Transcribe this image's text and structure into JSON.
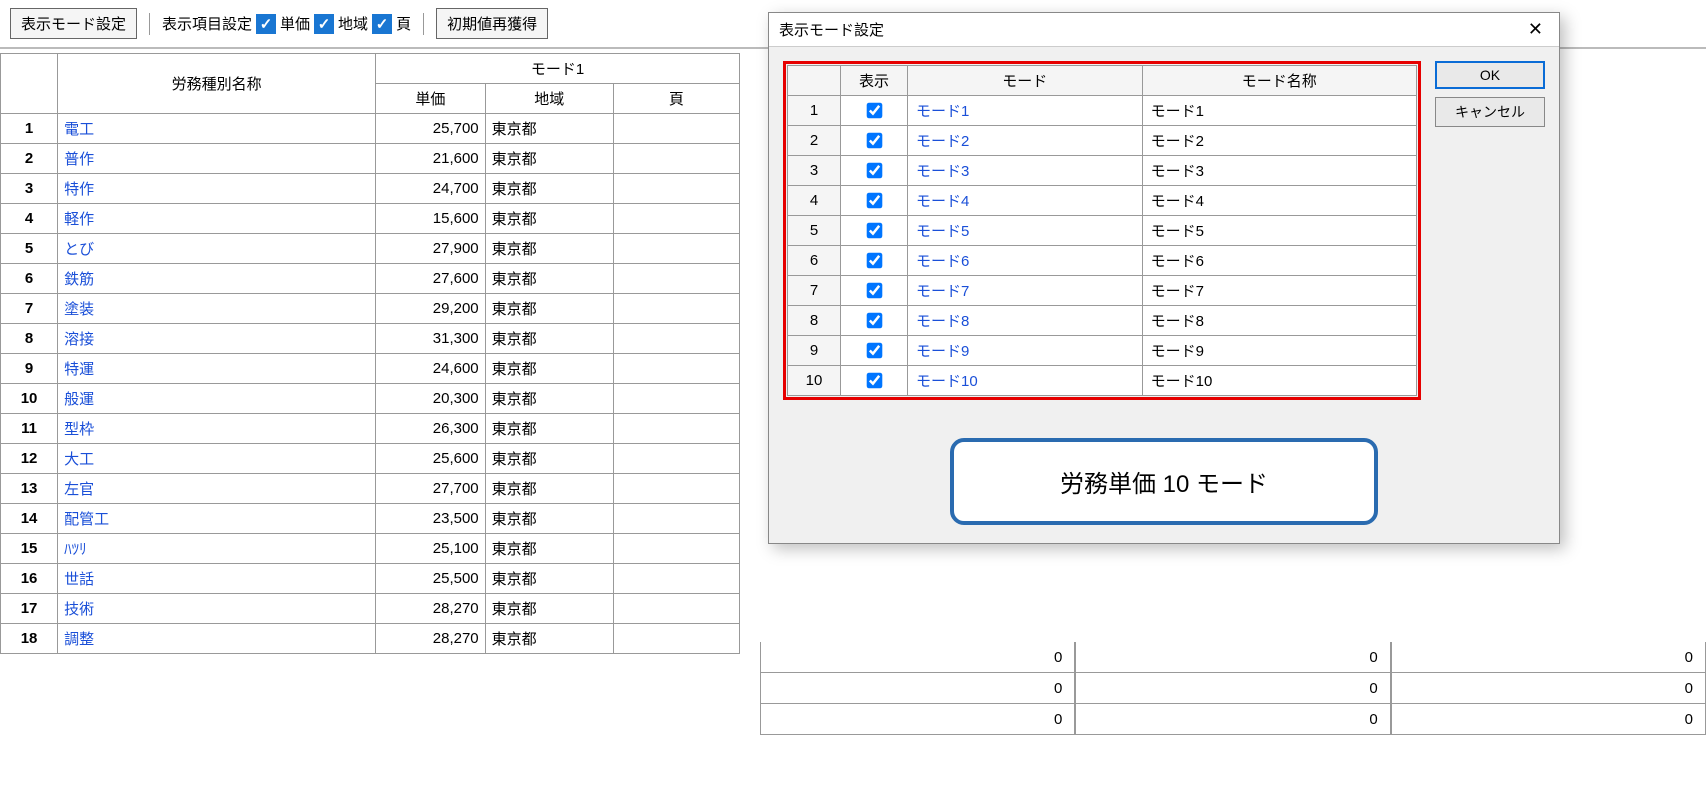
{
  "toolbar": {
    "mode_btn": "表示モード設定",
    "item_btn": "表示項目設定",
    "cb1_label": "単価",
    "cb2_label": "地域",
    "cb3_label": "頁",
    "reset_btn": "初期値再獲得"
  },
  "headers": {
    "labor_name": "労務種別名称",
    "mode_group": "モード1",
    "price": "単価",
    "region": "地域",
    "page": "頁"
  },
  "rows": [
    {
      "n": 1,
      "name": "電工",
      "price": "25,700",
      "region": "東京都",
      "page": ""
    },
    {
      "n": 2,
      "name": "普作",
      "price": "21,600",
      "region": "東京都",
      "page": ""
    },
    {
      "n": 3,
      "name": "特作",
      "price": "24,700",
      "region": "東京都",
      "page": ""
    },
    {
      "n": 4,
      "name": "軽作",
      "price": "15,600",
      "region": "東京都",
      "page": ""
    },
    {
      "n": 5,
      "name": "とび",
      "price": "27,900",
      "region": "東京都",
      "page": ""
    },
    {
      "n": 6,
      "name": "鉄筋",
      "price": "27,600",
      "region": "東京都",
      "page": ""
    },
    {
      "n": 7,
      "name": "塗装",
      "price": "29,200",
      "region": "東京都",
      "page": ""
    },
    {
      "n": 8,
      "name": "溶接",
      "price": "31,300",
      "region": "東京都",
      "page": ""
    },
    {
      "n": 9,
      "name": "特運",
      "price": "24,600",
      "region": "東京都",
      "page": ""
    },
    {
      "n": 10,
      "name": "般運",
      "price": "20,300",
      "region": "東京都",
      "page": ""
    },
    {
      "n": 11,
      "name": "型枠",
      "price": "26,300",
      "region": "東京都",
      "page": ""
    },
    {
      "n": 12,
      "name": "大工",
      "price": "25,600",
      "region": "東京都",
      "page": ""
    },
    {
      "n": 13,
      "name": "左官",
      "price": "27,700",
      "region": "東京都",
      "page": ""
    },
    {
      "n": 14,
      "name": "配管工",
      "price": "23,500",
      "region": "東京都",
      "page": ""
    },
    {
      "n": 15,
      "name": "ﾊﾂﾘ",
      "price": "25,100",
      "region": "東京都",
      "page": ""
    },
    {
      "n": 16,
      "name": "世話",
      "price": "25,500",
      "region": "東京都",
      "page": ""
    },
    {
      "n": 17,
      "name": "技術",
      "price": "28,270",
      "region": "東京都",
      "page": ""
    },
    {
      "n": 18,
      "name": "調整",
      "price": "28,270",
      "region": "東京都",
      "page": ""
    }
  ],
  "bg_zero": "0",
  "dialog": {
    "title": "表示モード設定",
    "ok": "OK",
    "cancel": "キャンセル",
    "hdr_disp": "表示",
    "hdr_mode": "モード",
    "hdr_name": "モード名称",
    "modes": [
      {
        "n": 1,
        "mode": "モード1",
        "name": "モード1"
      },
      {
        "n": 2,
        "mode": "モード2",
        "name": "モード2"
      },
      {
        "n": 3,
        "mode": "モード3",
        "name": "モード3"
      },
      {
        "n": 4,
        "mode": "モード4",
        "name": "モード4"
      },
      {
        "n": 5,
        "mode": "モード5",
        "name": "モード5"
      },
      {
        "n": 6,
        "mode": "モード6",
        "name": "モード6"
      },
      {
        "n": 7,
        "mode": "モード7",
        "name": "モード7"
      },
      {
        "n": 8,
        "mode": "モード8",
        "name": "モード8"
      },
      {
        "n": 9,
        "mode": "モード9",
        "name": "モード9"
      },
      {
        "n": 10,
        "mode": "モード10",
        "name": "モード10"
      }
    ],
    "callout": "労務単価 10 モード"
  }
}
